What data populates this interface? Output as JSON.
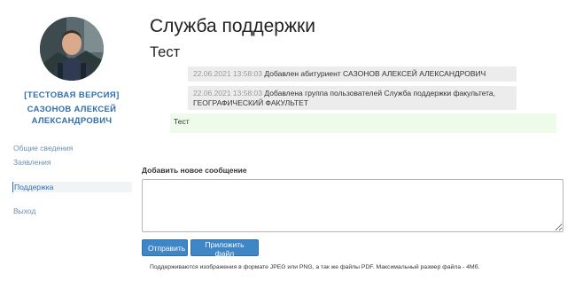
{
  "sidebar": {
    "version_label": "[ТЕСТОВАЯ ВЕРСИЯ]",
    "user_name_line1": "САЗОНОВ АЛЕКСЕЙ",
    "user_name_line2": "АЛЕКСАНДРОВИЧ",
    "nav": [
      {
        "label": "Общие сведения"
      },
      {
        "label": "Заявления"
      },
      {
        "label": "Поддержка",
        "active": true
      },
      {
        "label": "Выход"
      }
    ]
  },
  "main": {
    "title": "Служба поддержки",
    "subtitle": "Тест",
    "messages": [
      {
        "timestamp": "22.06.2021 13:58:03",
        "text": "Добавлен абитуриент САЗОНОВ АЛЕКСЕЙ АЛЕКСАНДРОВИЧ"
      },
      {
        "timestamp": "22.06.2021 13:58:03",
        "text_line1": "Добавлена группа пользователей Служба поддержки факультета,",
        "text_line2": "ГЕОГРАФИЧЕСКИЙ ФАКУЛЬТЕТ"
      }
    ],
    "own_message": "Тест",
    "form": {
      "label": "Добавить новое сообщение",
      "textarea_value": "",
      "send_label": "Отправить",
      "attach_label": "Приложить файл",
      "hint": "Поддерживаются изображения в формате JPEG или PNG, а так же файлы PDF. Максимальный размер файла - 4Мб."
    }
  },
  "colors": {
    "accent": "#2f6fad",
    "button": "#3f86c7",
    "system_message_bg": "#ececec",
    "own_message_bg": "#eefbea"
  }
}
